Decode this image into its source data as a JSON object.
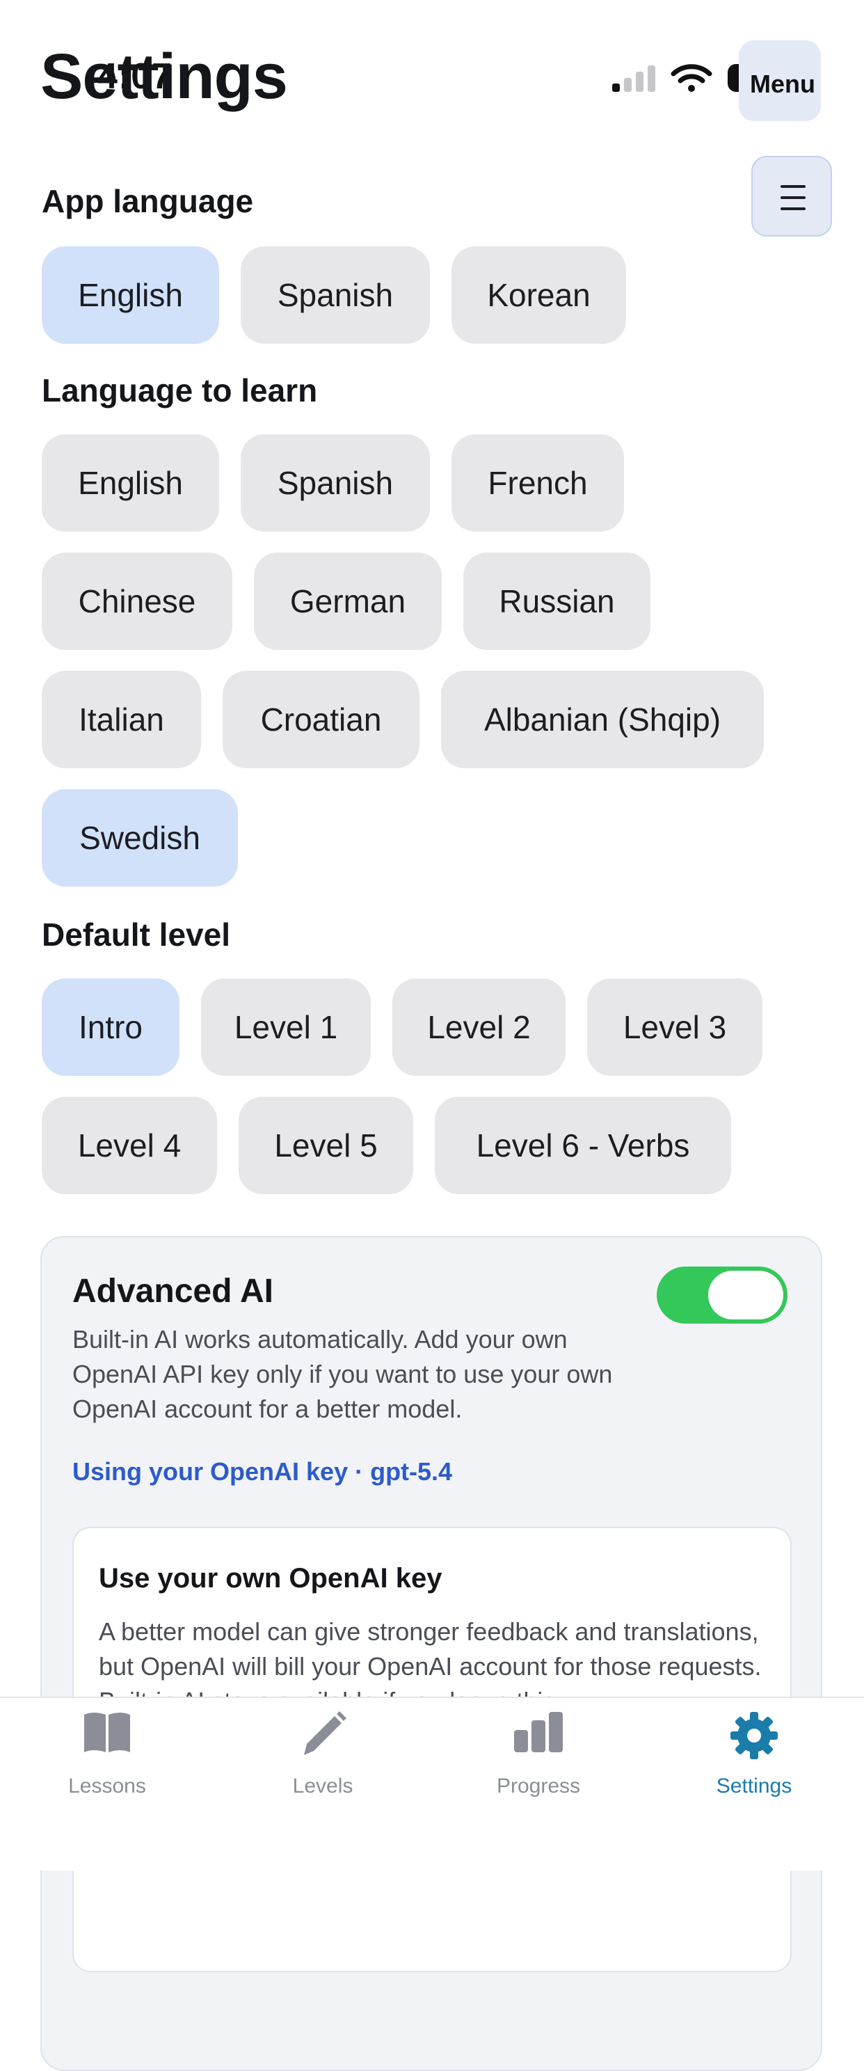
{
  "status_bar": {
    "time": "4:07",
    "battery": "71"
  },
  "header": {
    "title": "Settings",
    "menu_label": "Menu"
  },
  "app_language": {
    "heading": "App language",
    "options": [
      {
        "label": "English",
        "selected": true
      },
      {
        "label": "Spanish",
        "selected": false
      },
      {
        "label": "Korean",
        "selected": false
      }
    ]
  },
  "learn_language": {
    "heading": "Language to learn",
    "options": [
      {
        "label": "English",
        "selected": false
      },
      {
        "label": "Spanish",
        "selected": false
      },
      {
        "label": "French",
        "selected": false
      },
      {
        "label": "Chinese",
        "selected": false
      },
      {
        "label": "German",
        "selected": false
      },
      {
        "label": "Russian",
        "selected": false
      },
      {
        "label": "Italian",
        "selected": false
      },
      {
        "label": "Croatian",
        "selected": false
      },
      {
        "label": "Albanian (Shqip)",
        "selected": false
      },
      {
        "label": "Swedish",
        "selected": true
      }
    ]
  },
  "default_level": {
    "heading": "Default level",
    "options": [
      {
        "label": "Intro",
        "selected": true
      },
      {
        "label": "Level 1",
        "selected": false
      },
      {
        "label": "Level 2",
        "selected": false
      },
      {
        "label": "Level 3",
        "selected": false
      },
      {
        "label": "Level 4",
        "selected": false
      },
      {
        "label": "Level 5",
        "selected": false
      },
      {
        "label": "Level 6 - Verbs",
        "selected": false
      }
    ]
  },
  "advanced_ai": {
    "title": "Advanced AI",
    "enabled": true,
    "description": "Built-in AI works automatically. Add your own OpenAI API key only if you want to use your own OpenAI account for a better model.",
    "status": "Using your OpenAI key · gpt-5.4",
    "own_key": {
      "title": "Use your own OpenAI key",
      "description": "A better model can give stronger feedback and translations, but OpenAI will bill your OpenAI account for those requests. Built-in AI stays available if you leave this"
    }
  },
  "tab_bar": {
    "tabs": [
      {
        "label": "Lessons",
        "icon": "book-icon",
        "active": false
      },
      {
        "label": "Levels",
        "icon": "pencil-icon",
        "active": false
      },
      {
        "label": "Progress",
        "icon": "bar-chart-icon",
        "active": false
      },
      {
        "label": "Settings",
        "icon": "gear-icon",
        "active": true
      }
    ]
  },
  "colors": {
    "accent_selected_chip": "#d1e1fa",
    "chip": "#e7e7ea",
    "toggle_on": "#34c759",
    "link": "#2d5bc8",
    "active_tab": "#1b7cab"
  }
}
